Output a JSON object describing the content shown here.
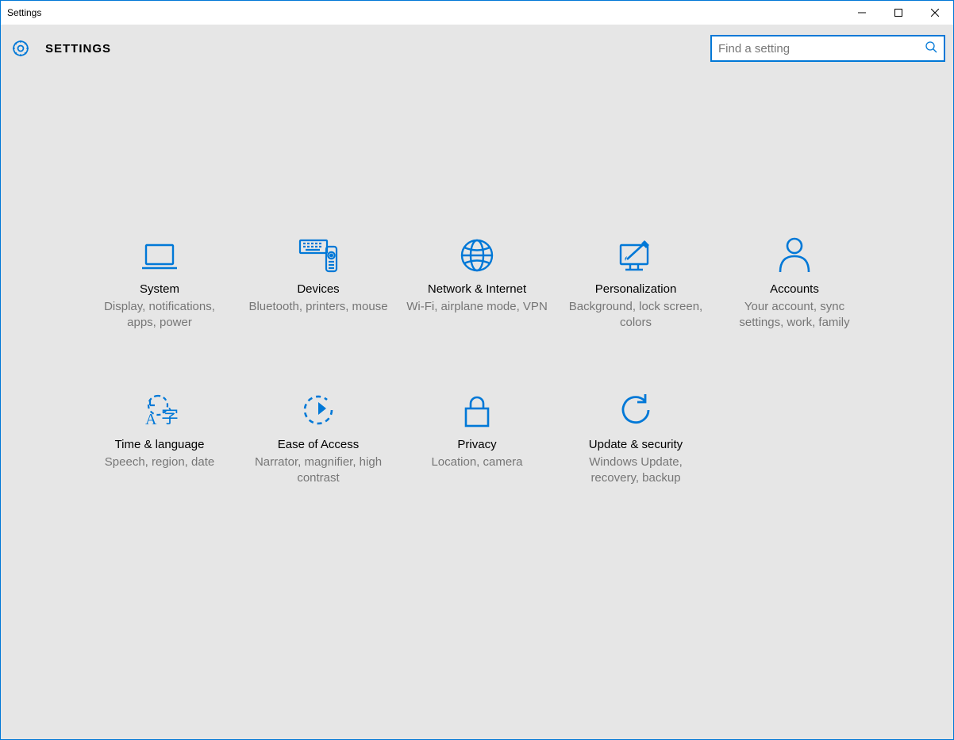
{
  "window": {
    "title": "Settings"
  },
  "header": {
    "app_title": "SETTINGS",
    "search": {
      "placeholder": "Find a setting",
      "value": ""
    }
  },
  "colors": {
    "accent": "#0078d7"
  },
  "categories": [
    {
      "id": "system",
      "icon": "laptop",
      "label": "System",
      "desc": "Display, notifications, apps, power"
    },
    {
      "id": "devices",
      "icon": "devices",
      "label": "Devices",
      "desc": "Bluetooth, printers, mouse"
    },
    {
      "id": "network",
      "icon": "globe",
      "label": "Network & Internet",
      "desc": "Wi-Fi, airplane mode, VPN"
    },
    {
      "id": "personalization",
      "icon": "brush",
      "label": "Personalization",
      "desc": "Background, lock screen, colors"
    },
    {
      "id": "accounts",
      "icon": "person",
      "label": "Accounts",
      "desc": "Your account, sync settings, work, family"
    },
    {
      "id": "time-language",
      "icon": "time-lang",
      "label": "Time & language",
      "desc": "Speech, region, date"
    },
    {
      "id": "ease-of-access",
      "icon": "ease",
      "label": "Ease of Access",
      "desc": "Narrator, magnifier, high contrast"
    },
    {
      "id": "privacy",
      "icon": "lock",
      "label": "Privacy",
      "desc": "Location, camera"
    },
    {
      "id": "update-security",
      "icon": "update",
      "label": "Update & security",
      "desc": "Windows Update, recovery, backup"
    }
  ]
}
